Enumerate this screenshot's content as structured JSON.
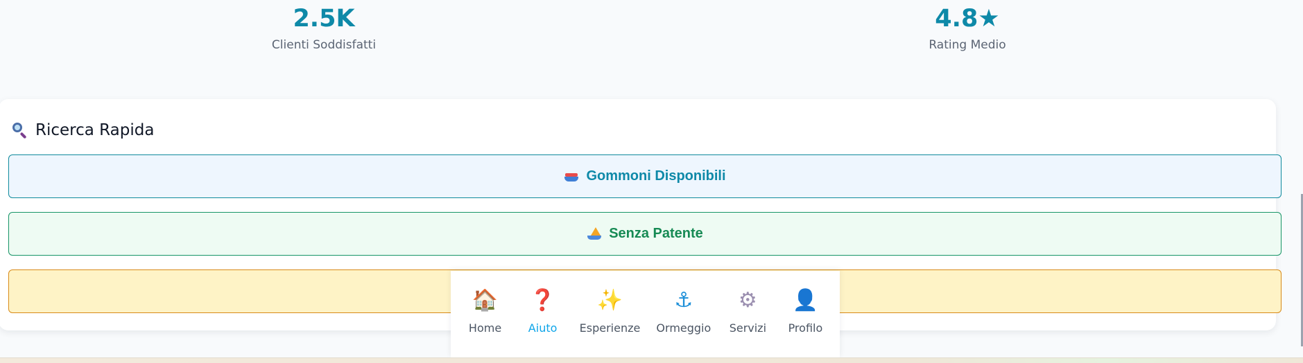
{
  "stats": [
    {
      "value": "2.5K",
      "label": "Clienti Soddisfatti"
    },
    {
      "value": "4.8★",
      "label": "Rating Medio"
    }
  ],
  "quick_search": {
    "title": "Ricerca Rapida",
    "title_icon": "magnifying-glass-icon",
    "buttons": [
      {
        "label": "Gommoni Disponibili",
        "icon": "speedboat-icon",
        "color": "#0e89a8"
      },
      {
        "label": "Senza Patente",
        "icon": "sailboat-icon",
        "color": "#168a54"
      },
      {
        "label": "",
        "icon": "",
        "color": "#b45309"
      }
    ]
  },
  "bottom_nav": {
    "active": "Aiuto",
    "items": [
      {
        "label": "Home",
        "icon": "🏠",
        "icon_name": "house-icon"
      },
      {
        "label": "Aiuto",
        "icon": "❓",
        "icon_name": "question-mark-icon"
      },
      {
        "label": "Esperienze",
        "icon": "✨",
        "icon_name": "sparkles-icon"
      },
      {
        "label": "Ormeggio",
        "icon": "⚓",
        "icon_name": "anchor-icon"
      },
      {
        "label": "Servizi",
        "icon": "⚙",
        "icon_name": "gear-icon"
      },
      {
        "label": "Profilo",
        "icon": "👤",
        "icon_name": "person-icon"
      }
    ]
  },
  "colors": {
    "accent": "#0e89a8",
    "active_nav": "#0ea5e9",
    "green": "#168a54",
    "amber": "#d88a17"
  }
}
